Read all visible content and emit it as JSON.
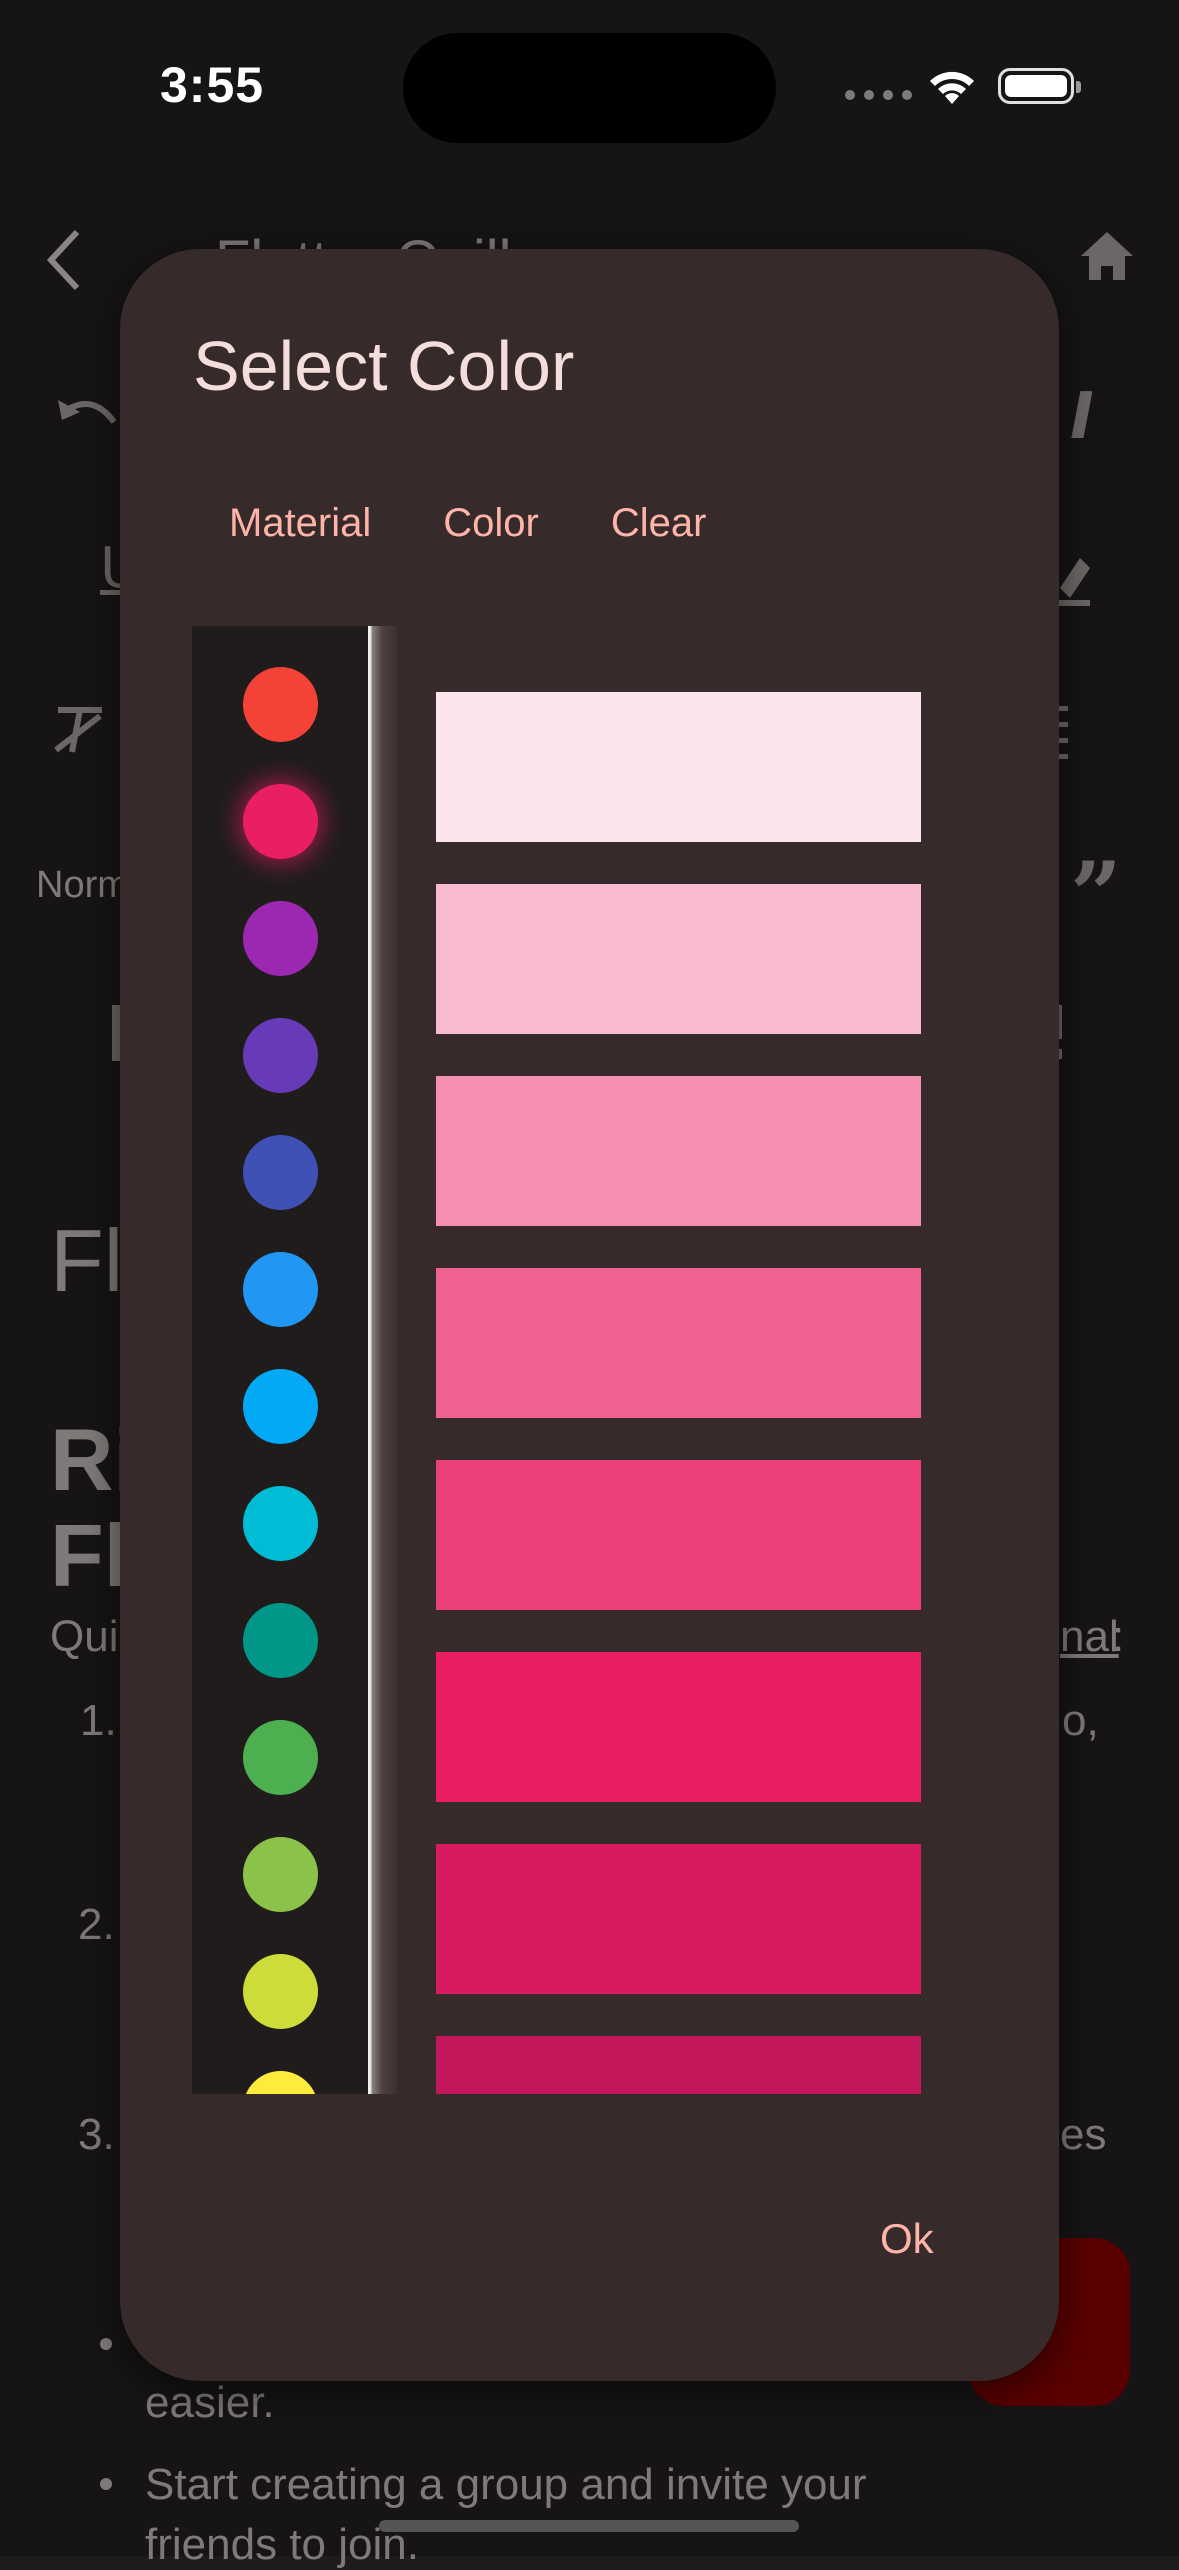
{
  "status_bar": {
    "time": "3:55"
  },
  "background": {
    "nav_title": "Flutter Quill",
    "style_label": "Norm",
    "heading_partial": "Fl",
    "bold_heading_1": "Ri",
    "bold_heading_2": "Fl",
    "paragraph_start": "Qui",
    "paragraph_link_fragment": "nal",
    "paragraph_colon": ":",
    "list_num_1": "1.",
    "list_num_1_tail": "o,",
    "list_num_2": "2.",
    "list_num_3": "3.",
    "list_num_3_tail": "es",
    "bullet_1_tail": "easier.",
    "bullet_2_line1": "Start creating a group and invite your",
    "bullet_2_line2": "friends to join."
  },
  "dialog": {
    "title": "Select Color",
    "tabs": [
      "Material",
      "Color",
      "Clear"
    ],
    "ok_label": "Ok",
    "colors": {
      "palette": [
        "#f44336",
        "#e91e63",
        "#9c27b0",
        "#673ab7",
        "#3f51b5",
        "#2196f3",
        "#03a9f4",
        "#00bcd4",
        "#009688",
        "#4caf50",
        "#8bc34a",
        "#cddc39",
        "#ffeb3b"
      ],
      "selected": "#e91e63",
      "shades": [
        "#fce4ec",
        "#f8bbd0",
        "#f48fb1",
        "#f06292",
        "#ec407a",
        "#e91e63",
        "#d81b60",
        "#c2185b"
      ]
    }
  }
}
